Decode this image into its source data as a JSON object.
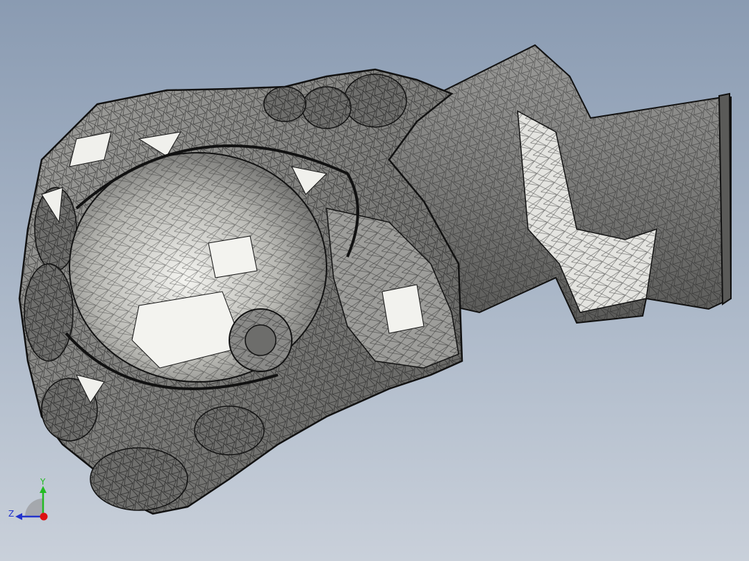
{
  "viewport": {
    "background_top": "#8a9bb2",
    "background_bottom": "#c9d0da",
    "model": {
      "render_style": "shaded-with-mesh-edges",
      "fill_color": "#8c8c8c",
      "edge_color": "#111111",
      "highlight_color": "#f2f2ee"
    }
  },
  "triad": {
    "y_label": "Y",
    "z_label": "Z",
    "y_color": "#22bb22",
    "z_color": "#2233cc",
    "x_color": "#dd1111"
  }
}
